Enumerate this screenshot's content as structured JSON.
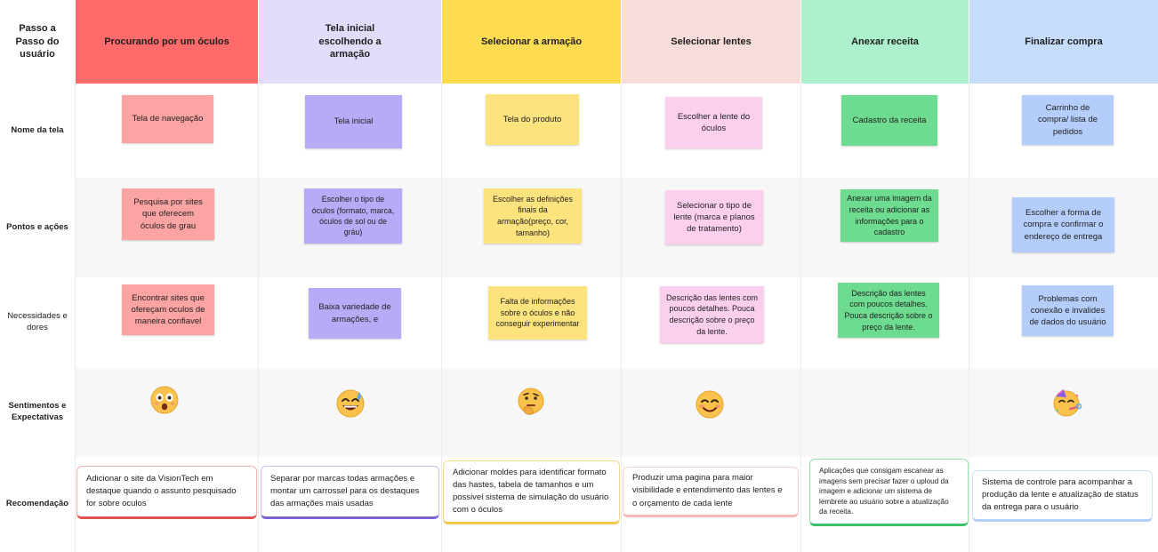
{
  "header": {
    "row_title": "Passo a Passo do usuário",
    "columns": [
      {
        "label": "Procurando por um óculos",
        "color": "#ff6b6b"
      },
      {
        "label": "Tela inicial escolhendo a armação",
        "color": "#e2dcfa"
      },
      {
        "label": "Selecionar a armação",
        "color": "#fddc52"
      },
      {
        "label": "Selecionar lentes",
        "color": "#f9dcdc"
      },
      {
        "label": "Anexar receita",
        "color": "#acf0cd"
      },
      {
        "label": "Finalizar compra",
        "color": "#c5dcfb"
      }
    ]
  },
  "rows": {
    "screen": "Nome da tela",
    "actions": "Pontos e ações",
    "needs": "Necessidades e dores",
    "feelings": "Sentimentos e Expectativas",
    "recommendation": "Recomendação"
  },
  "screens": [
    {
      "text": "Tela de navegação",
      "color": "#fca3a3"
    },
    {
      "text": "Tela inicial",
      "color": "#b8aaf6"
    },
    {
      "text": "Tela do produto",
      "color": "#fde37e"
    },
    {
      "text": "Escolher a lente do óculos",
      "color": "#fccfef"
    },
    {
      "text": "Cadastro da receita",
      "color": "#6edc90"
    },
    {
      "text": "Carrinho de compra/ lista de pedidos",
      "color": "#b4cdfb"
    }
  ],
  "actions": [
    {
      "text": "Pesquisa por sites que oferecem óculos de grau",
      "color": "#fca3a3"
    },
    {
      "text": "Escolher o tipo de óculos (formato, marca, óculos de sol ou de gráu)",
      "color": "#b8aaf6"
    },
    {
      "text": "Escolher as definições finais da armação(preço, cor, tamanho)",
      "color": "#fde37e"
    },
    {
      "text": "Selecionar o tipo de lente (marca e planos de tratamento)",
      "color": "#fccfef"
    },
    {
      "text": "Anexar uma imagem da receita ou adicionar as informações para o cadastro",
      "color": "#6edc90"
    },
    {
      "text": "Escolher a forma de compra e confirmar o endereço de entrega",
      "color": "#b4cdfb"
    }
  ],
  "needs": [
    {
      "text": "Encontrar sites que ofereçam oculos de maneira confiavel",
      "color": "#fca3a3"
    },
    {
      "text": "Baixa variedade de armações, e",
      "color": "#b8aaf6"
    },
    {
      "text": "Falta de informações sobre o óculos e não conseguir experimentar",
      "color": "#fde37e"
    },
    {
      "text": "Descrição das lentes com poucos detalhes. Pouca descrição sobre o preço da lente.",
      "color": "#fccfef"
    },
    {
      "text": "Descrição das lentes com poucos detalhes. Pouca descrição sobre o preço da lente.",
      "color": "#6edc90"
    },
    {
      "text": "Problemas com conexão e invalides de dados do usuário",
      "color": "#b4cdfb"
    }
  ],
  "feelings": [
    {
      "icon": "astonished-face-icon"
    },
    {
      "icon": "grinning-sweat-face-icon"
    },
    {
      "icon": "thinking-face-icon"
    },
    {
      "icon": "smiling-face-icon"
    },
    {
      "icon": ""
    },
    {
      "icon": "partying-face-icon"
    }
  ],
  "recommendations": [
    {
      "text": "Adicionar o site da VisionTech em destaque quando o assunto pesquisado for sobre oculos",
      "border": "#e05252"
    },
    {
      "text": "Separar por marcas todas armações e montar um carrossel para os destaques das armações mais usadas",
      "border": "#7b63d6"
    },
    {
      "text": "Adicionar moldes para identificar formato das hastes, tabela de tamanhos e um possivel sistema de simulação do usuário com o óculos",
      "border": "#f2c94c"
    },
    {
      "text": "Produzir uma pagina para maior visibilidade e entendimento das lentes e o orçamento de cada lente",
      "border": "#f4b8b8"
    },
    {
      "text": "Aplicações que consigam escanear as imagens sem precisar fazer o uploud da imagem e adicionar um sistema de lembrete ao usuário sobre a atualização da receita.",
      "border": "#3fbf6a"
    },
    {
      "text": "Sistema de controle para acompanhar a produção da lente e atualização de status da entrega para o usuário",
      "border": "#b4cdfb"
    }
  ]
}
